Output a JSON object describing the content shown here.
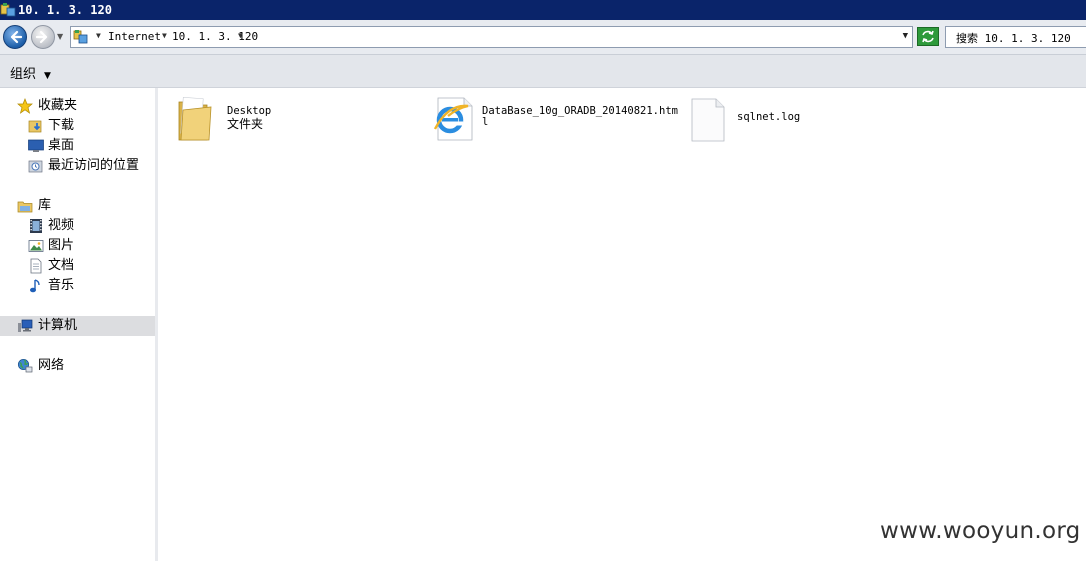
{
  "window": {
    "title": "10. 1. 3. 120"
  },
  "address_bar": {
    "breadcrumbs": [
      {
        "label": "Internet"
      },
      {
        "label": "10. 1. 3. 120"
      }
    ],
    "search_placeholder": "搜索 10. 1. 3. 120"
  },
  "command_bar": {
    "organize_label": "组织"
  },
  "sidebar": {
    "favorites": {
      "label": "收藏夹",
      "items": [
        {
          "label": "下载",
          "icon": "downloads-folder-icon"
        },
        {
          "label": "桌面",
          "icon": "desktop-icon"
        },
        {
          "label": "最近访问的位置",
          "icon": "recent-places-icon"
        }
      ]
    },
    "libraries": {
      "label": "库",
      "items": [
        {
          "label": "视频",
          "icon": "video-library-icon"
        },
        {
          "label": "图片",
          "icon": "pictures-library-icon"
        },
        {
          "label": "文档",
          "icon": "documents-library-icon"
        },
        {
          "label": "音乐",
          "icon": "music-note-icon"
        }
      ]
    },
    "computer": {
      "label": "计算机",
      "selected": true
    },
    "network": {
      "label": "网络"
    }
  },
  "files": [
    {
      "name": "Desktop",
      "type": "文件夹",
      "icon": "folder-icon"
    },
    {
      "name": "DataBase_10g_ORADB_20140821.htm",
      "name_wrap": "l",
      "icon": "ie-html-file-icon"
    },
    {
      "name": "sqlnet.log",
      "icon": "blank-file-icon"
    }
  ],
  "watermark": "www.wooyun.org",
  "colors": {
    "titlebar": "#0a246a",
    "selection": "#dcdde0"
  }
}
